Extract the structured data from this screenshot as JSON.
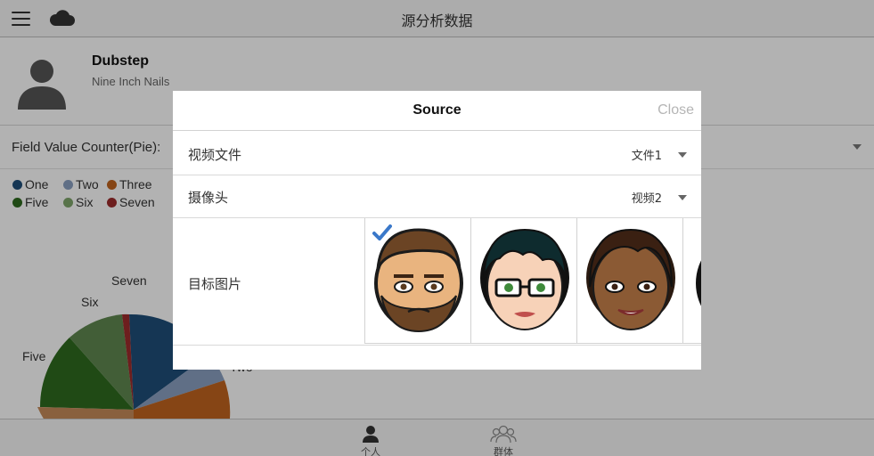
{
  "header": {
    "title": "源分析数据",
    "menu_icon": "menu-icon",
    "cloud_icon": "cloud-icon"
  },
  "profile": {
    "name": "Dubstep",
    "subtitle": "Nine Inch Nails",
    "avatar_icon": "user-silhouette-icon"
  },
  "field": {
    "label": "Field Value Counter(Pie):"
  },
  "legend": {
    "items": [
      {
        "label": "One",
        "color": "#1f4e79"
      },
      {
        "label": "Two",
        "color": "#8a9fc1"
      },
      {
        "label": "Three",
        "color": "#c0641f"
      },
      {
        "label": "Five",
        "color": "#2f6b1f"
      },
      {
        "label": "Six",
        "color": "#7fa56a"
      },
      {
        "label": "Seven",
        "color": "#9c2b2b"
      }
    ]
  },
  "pie_labels": {
    "seven": "Seven",
    "six": "Six",
    "five": "Five",
    "two": "Two"
  },
  "bottom_tabs": [
    {
      "label": "个人",
      "icon": "person-icon"
    },
    {
      "label": "群体",
      "icon": "group-icon"
    }
  ],
  "modal": {
    "title": "Source",
    "close": "Close",
    "rows": [
      {
        "label": "视频文件",
        "value": "文件1"
      },
      {
        "label": "摄像头",
        "value": "视频2"
      },
      {
        "label": "目标图片"
      }
    ],
    "faces": [
      {
        "name": "bearded-man-face",
        "selected": true
      },
      {
        "name": "woman-glasses-face",
        "selected": false
      },
      {
        "name": "dark-woman-face",
        "selected": false
      },
      {
        "name": "partial-face",
        "selected": false
      }
    ]
  },
  "colors": {
    "accent": "#3a78c9",
    "pie_blue": "#1f4e79",
    "pie_orange": "#c0641f",
    "pie_green": "#2f6b1f"
  }
}
